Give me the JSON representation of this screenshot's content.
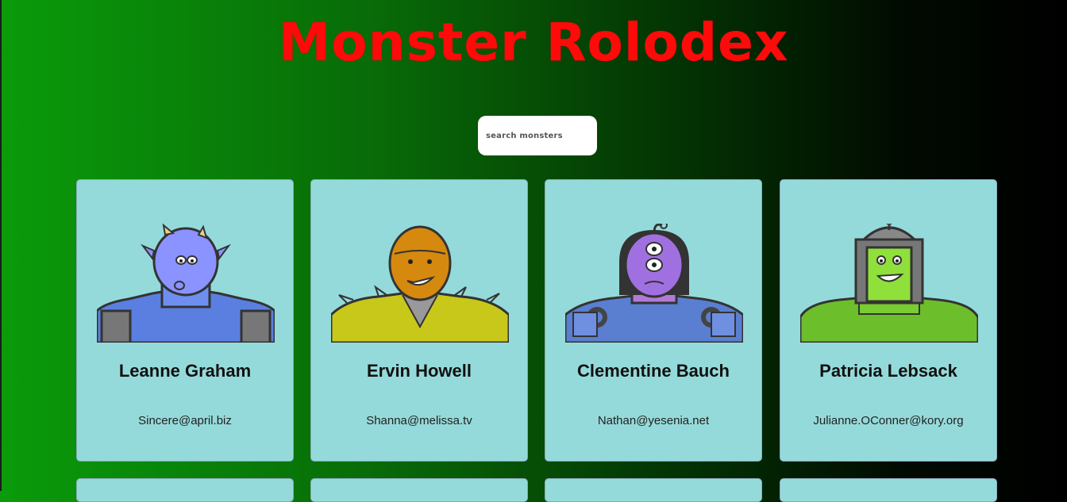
{
  "app": {
    "title": "Monster Rolodex"
  },
  "search": {
    "placeholder": "search monsters"
  },
  "monsters": [
    {
      "name": "Leanne Graham",
      "email": "Sincere@april.biz",
      "icon": "blue-horned-monster-icon"
    },
    {
      "name": "Ervin Howell",
      "email": "Shanna@melissa.tv",
      "icon": "orange-spiky-monster-icon"
    },
    {
      "name": "Clementine Bauch",
      "email": "Nathan@yesenia.net",
      "icon": "purple-cyclops-robot-monster-icon"
    },
    {
      "name": "Patricia Lebsack",
      "email": "Julianne.OConner@kory.org",
      "icon": "green-helmet-monster-icon"
    }
  ],
  "colors": {
    "title": "#ff0a0a",
    "card_bg": "#95dada",
    "bg_start": "#0a9b0a",
    "bg_end": "#000000"
  }
}
